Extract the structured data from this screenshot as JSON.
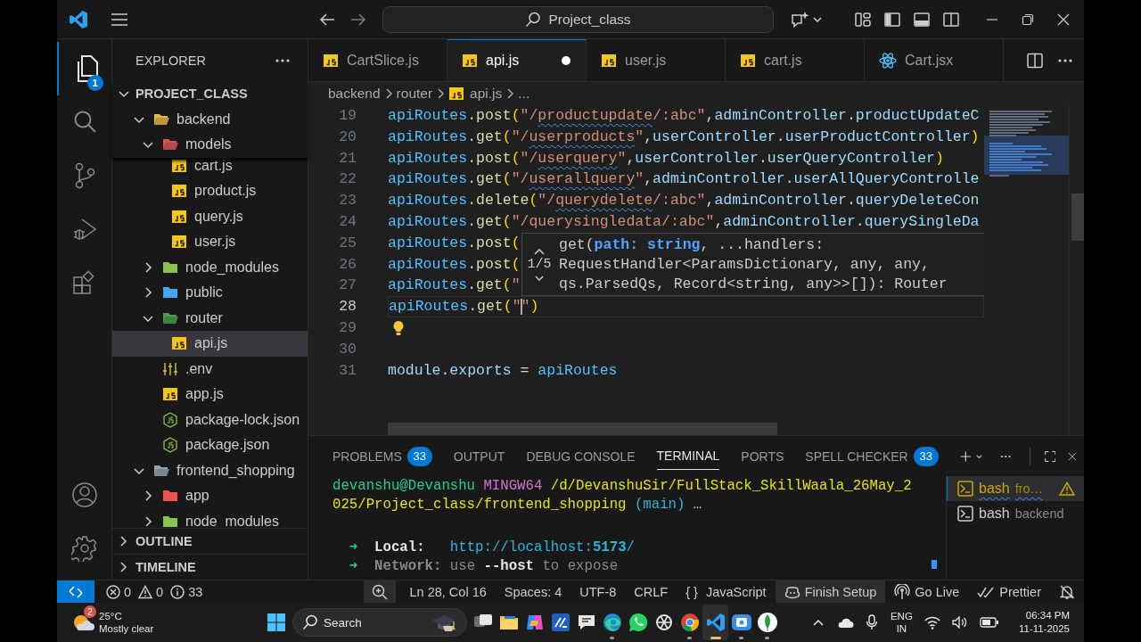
{
  "title_bar": {
    "nav": [
      {
        "kind": "back",
        "disabled": false
      },
      {
        "kind": "forward",
        "disabled": true
      }
    ],
    "search": "Project_class"
  },
  "activity_bar": {
    "items": [
      {
        "kind": "explorer",
        "selected": true,
        "badge": "1"
      },
      {
        "kind": "search",
        "selected": false
      },
      {
        "kind": "source-control",
        "selected": false
      },
      {
        "kind": "run-debug",
        "selected": false
      },
      {
        "kind": "extensions",
        "selected": false
      }
    ],
    "bottom": [
      {
        "kind": "account"
      },
      {
        "kind": "settings"
      }
    ]
  },
  "sidebar": {
    "title": "EXPLORER",
    "tree": [
      {
        "label": "PROJECT_CLASS",
        "kind": "root",
        "expanded": true,
        "selected": false,
        "children": [
          {
            "label": "backend",
            "kind": "folder",
            "color": "#e8b84a",
            "expanded": true,
            "selected": false,
            "children": [
              {
                "label": "models",
                "kind": "folder",
                "color": "#e05252",
                "expanded": true,
                "selected": false,
                "children": [
                  {
                    "label": "cart.js",
                    "kind": "js",
                    "selected": false
                  },
                  {
                    "label": "product.js",
                    "kind": "js",
                    "selected": false
                  },
                  {
                    "label": "query.js",
                    "kind": "js",
                    "selected": false
                  },
                  {
                    "label": "user.js",
                    "kind": "js",
                    "selected": false
                  }
                ]
              },
              {
                "label": "node_modules",
                "kind": "folder",
                "color": "#8bc34a",
                "expanded": false,
                "selected": false
              },
              {
                "label": "public",
                "kind": "folder",
                "color": "#42a5f5",
                "expanded": false,
                "selected": false
              },
              {
                "label": "router",
                "kind": "folder",
                "color": "#43a047",
                "expanded": true,
                "selected": false,
                "children": [
                  {
                    "label": "api.js",
                    "kind": "js",
                    "selected": true
                  }
                ]
              },
              {
                "label": ".env",
                "kind": "env",
                "selected": false
              },
              {
                "label": "app.js",
                "kind": "js",
                "selected": false
              },
              {
                "label": "package-lock.json",
                "kind": "json",
                "selected": false
              },
              {
                "label": "package.json",
                "kind": "json",
                "selected": false
              }
            ]
          },
          {
            "label": "frontend_shopping",
            "kind": "folder",
            "color": "#90a4ae",
            "expanded": true,
            "selected": false,
            "children": [
              {
                "label": "app",
                "kind": "folder",
                "color": "#ef5350",
                "expanded": false,
                "selected": false
              },
              {
                "label": "node_modules",
                "kind": "folder",
                "color": "#8bc34a",
                "expanded": false,
                "selected": false
              }
            ]
          }
        ]
      }
    ],
    "sections": [
      {
        "label": "OUTLINE",
        "expanded": false
      },
      {
        "label": "TIMELINE",
        "expanded": false
      }
    ]
  },
  "editor": {
    "tabs": [
      {
        "label": "CartSlice.js",
        "kind": "js",
        "selected": false,
        "modified": false
      },
      {
        "label": "api.js",
        "kind": "js",
        "selected": true,
        "modified": true
      },
      {
        "label": "user.js",
        "kind": "js",
        "selected": false,
        "modified": false
      },
      {
        "label": "cart.js",
        "kind": "js",
        "selected": false,
        "modified": false
      },
      {
        "label": "Cart.jsx",
        "kind": "react",
        "selected": false,
        "modified": false
      }
    ],
    "breadcrumb": [
      {
        "label": "backend",
        "kind": "folder"
      },
      {
        "label": "router",
        "kind": "folder"
      },
      {
        "label": "api.js",
        "kind": "js"
      },
      {
        "label": "...",
        "kind": "more"
      }
    ],
    "lines": [
      {
        "number": "19",
        "current": false,
        "lightbulb": false,
        "tokens": [
          {
            "kind": "const",
            "text": "apiRoutes"
          },
          {
            "kind": "punc",
            "text": "."
          },
          {
            "kind": "method",
            "text": "post"
          },
          {
            "kind": "bracket",
            "text": "("
          },
          {
            "kind": "str",
            "text": "\"/"
          },
          {
            "kind": "str-warn",
            "text": "productupdate"
          },
          {
            "kind": "str",
            "text": "/:abc\""
          },
          {
            "kind": "punc",
            "text": ","
          },
          {
            "kind": "var",
            "text": "adminController"
          },
          {
            "kind": "punc",
            "text": "."
          },
          {
            "kind": "var",
            "text": "productUpdateC"
          }
        ]
      },
      {
        "number": "20",
        "current": false,
        "lightbulb": false,
        "tokens": [
          {
            "kind": "const",
            "text": "apiRoutes"
          },
          {
            "kind": "punc",
            "text": "."
          },
          {
            "kind": "method",
            "text": "get"
          },
          {
            "kind": "bracket",
            "text": "("
          },
          {
            "kind": "str",
            "text": "\"/"
          },
          {
            "kind": "str-warn",
            "text": "userproducts"
          },
          {
            "kind": "str",
            "text": "\""
          },
          {
            "kind": "punc",
            "text": ","
          },
          {
            "kind": "var",
            "text": "userController"
          },
          {
            "kind": "punc",
            "text": "."
          },
          {
            "kind": "var",
            "text": "userProductController"
          },
          {
            "kind": "bracket",
            "text": ")"
          }
        ]
      },
      {
        "number": "21",
        "current": false,
        "lightbulb": false,
        "tokens": [
          {
            "kind": "const",
            "text": "apiRoutes"
          },
          {
            "kind": "punc",
            "text": "."
          },
          {
            "kind": "method",
            "text": "post"
          },
          {
            "kind": "bracket",
            "text": "("
          },
          {
            "kind": "str",
            "text": "\"/"
          },
          {
            "kind": "str-warn",
            "text": "userquery"
          },
          {
            "kind": "str",
            "text": "\""
          },
          {
            "kind": "punc",
            "text": ","
          },
          {
            "kind": "var",
            "text": "userController"
          },
          {
            "kind": "punc",
            "text": "."
          },
          {
            "kind": "var",
            "text": "userQueryController"
          },
          {
            "kind": "bracket",
            "text": ")"
          }
        ]
      },
      {
        "number": "22",
        "current": false,
        "lightbulb": false,
        "tokens": [
          {
            "kind": "const",
            "text": "apiRoutes"
          },
          {
            "kind": "punc",
            "text": "."
          },
          {
            "kind": "method",
            "text": "get"
          },
          {
            "kind": "bracket",
            "text": "("
          },
          {
            "kind": "str",
            "text": "\"/"
          },
          {
            "kind": "str-warn",
            "text": "userallquery"
          },
          {
            "kind": "str",
            "text": "\""
          },
          {
            "kind": "punc",
            "text": ","
          },
          {
            "kind": "var",
            "text": "adminController"
          },
          {
            "kind": "punc",
            "text": "."
          },
          {
            "kind": "var",
            "text": "userAllQueryControlle"
          }
        ]
      },
      {
        "number": "23",
        "current": false,
        "lightbulb": false,
        "tokens": [
          {
            "kind": "const",
            "text": "apiRoutes"
          },
          {
            "kind": "punc",
            "text": "."
          },
          {
            "kind": "method",
            "text": "delete"
          },
          {
            "kind": "bracket",
            "text": "("
          },
          {
            "kind": "str",
            "text": "\"/"
          },
          {
            "kind": "str-warn",
            "text": "querydelete"
          },
          {
            "kind": "str",
            "text": "/:abc\""
          },
          {
            "kind": "punc",
            "text": ","
          },
          {
            "kind": "var",
            "text": "adminController"
          },
          {
            "kind": "punc",
            "text": "."
          },
          {
            "kind": "var",
            "text": "queryDeleteCon"
          }
        ]
      },
      {
        "number": "24",
        "current": false,
        "lightbulb": false,
        "tokens": [
          {
            "kind": "const",
            "text": "apiRoutes"
          },
          {
            "kind": "punc",
            "text": "."
          },
          {
            "kind": "method",
            "text": "get"
          },
          {
            "kind": "bracket",
            "text": "("
          },
          {
            "kind": "str",
            "text": "\"/querysingledata/:abc\""
          },
          {
            "kind": "punc",
            "text": ","
          },
          {
            "kind": "var",
            "text": "adminController"
          },
          {
            "kind": "punc",
            "text": "."
          },
          {
            "kind": "var",
            "text": "querySingleDa"
          }
        ]
      },
      {
        "number": "25",
        "current": false,
        "lightbulb": false,
        "tokens": [
          {
            "kind": "const",
            "text": "apiRoutes"
          },
          {
            "kind": "punc",
            "text": "."
          },
          {
            "kind": "method",
            "text": "post"
          },
          {
            "kind": "bracket",
            "text": "("
          }
        ]
      },
      {
        "number": "26",
        "current": false,
        "lightbulb": false,
        "tokens": [
          {
            "kind": "const",
            "text": "apiRoutes"
          },
          {
            "kind": "punc",
            "text": "."
          },
          {
            "kind": "method",
            "text": "post"
          },
          {
            "kind": "bracket",
            "text": "("
          }
        ]
      },
      {
        "number": "27",
        "current": false,
        "lightbulb": false,
        "tokens": [
          {
            "kind": "const",
            "text": "apiRoutes"
          },
          {
            "kind": "punc",
            "text": "."
          },
          {
            "kind": "method",
            "text": "get"
          },
          {
            "kind": "bracket",
            "text": "("
          },
          {
            "kind": "str",
            "text": "\""
          }
        ]
      },
      {
        "number": "28",
        "current": true,
        "lightbulb": false,
        "tokens": [
          {
            "kind": "const",
            "text": "apiRoutes"
          },
          {
            "kind": "punc",
            "text": "."
          },
          {
            "kind": "method",
            "text": "get"
          },
          {
            "kind": "bracket",
            "text": "("
          },
          {
            "kind": "str",
            "text": "\""
          },
          {
            "kind": "cursor"
          },
          {
            "kind": "str",
            "text": "\""
          },
          {
            "kind": "bracket",
            "text": ")"
          }
        ]
      },
      {
        "number": "29",
        "current": false,
        "lightbulb": true
      },
      {
        "number": "30",
        "current": false,
        "lightbulb": false
      },
      {
        "number": "31",
        "current": false,
        "lightbulb": false,
        "tokens": [
          {
            "kind": "var",
            "text": "module"
          },
          {
            "kind": "punc",
            "text": "."
          },
          {
            "kind": "var",
            "text": "exports"
          },
          {
            "kind": "punc",
            "text": " = "
          },
          {
            "kind": "const",
            "text": "apiRoutes"
          }
        ]
      }
    ],
    "hover": {
      "counter": "1/5",
      "lines": [
        "get(**path: string**, ...handlers:",
        "RequestHandler<ParamsDictionary, any, any,",
        "qs.ParsedQs, Record<string, any>>[]): Router"
      ]
    }
  },
  "panel": {
    "tabs": [
      {
        "label": "PROBLEMS",
        "badge": "33",
        "selected": false
      },
      {
        "label": "OUTPUT",
        "selected": false
      },
      {
        "label": "DEBUG CONSOLE",
        "selected": false
      },
      {
        "label": "TERMINAL",
        "selected": true
      },
      {
        "label": "PORTS",
        "selected": false
      },
      {
        "label": "SPELL CHECKER",
        "badge": "33",
        "selected": false
      }
    ],
    "terminal": [
      {
        "kind": "text",
        "segments": [
          {
            "kind": "user",
            "text": "devanshu@Devanshu "
          },
          {
            "kind": "host",
            "text": "MINGW64 "
          },
          {
            "kind": "path",
            "text": "/d/DevanshuSir/FullStack_SkillWaala_26May_2"
          }
        ]
      },
      {
        "kind": "text",
        "segments": [
          {
            "kind": "path",
            "text": "025/Project_class/frontend_shopping "
          },
          {
            "kind": "branch",
            "text": "(main)"
          },
          {
            "kind": "plain",
            "text": " …"
          }
        ]
      },
      {
        "kind": "blank"
      },
      {
        "kind": "text",
        "segments": [
          {
            "kind": "arrow",
            "text": "  ➜  "
          },
          {
            "kind": "label",
            "text": "Local:   "
          },
          {
            "kind": "link",
            "text": "http://localhost:"
          },
          {
            "kind": "link-bold",
            "text": "5173"
          },
          {
            "kind": "link",
            "text": "/"
          }
        ]
      },
      {
        "kind": "text",
        "segments": [
          {
            "kind": "arrow",
            "text": "  ➜  "
          },
          {
            "kind": "label-dim",
            "text": "Network:"
          },
          {
            "kind": "dim",
            "text": " use "
          },
          {
            "kind": "label",
            "text": "--host"
          },
          {
            "kind": "dim",
            "text": " to expose"
          }
        ]
      }
    ],
    "sessions": [
      {
        "label": "bash",
        "detail": "fro…",
        "warning": true,
        "selected": true
      },
      {
        "label": "bash",
        "detail": "backend",
        "warning": false,
        "selected": false
      }
    ]
  },
  "status_bar": {
    "problems": {
      "errors": "0",
      "warnings": "0",
      "infos": "33"
    },
    "items": [
      {
        "kind": "zoom",
        "highlighted": true
      },
      {
        "kind": "text",
        "text": "Ln 28, Col 16",
        "highlighted": false
      },
      {
        "kind": "text",
        "text": "Spaces: 4",
        "highlighted": false
      },
      {
        "kind": "text",
        "text": "UTF-8",
        "highlighted": false
      },
      {
        "kind": "text",
        "text": "CRLF",
        "highlighted": false
      },
      {
        "kind": "language",
        "glyph": "{ }",
        "text": "JavaScript",
        "highlighted": false
      },
      {
        "kind": "copilot",
        "text": "Finish Setup",
        "highlighted": true
      },
      {
        "kind": "live",
        "text": "Go Live",
        "highlighted": false
      },
      {
        "kind": "prettier",
        "text": "Prettier",
        "highlighted": false
      },
      {
        "kind": "bell",
        "highlighted": false
      }
    ]
  },
  "taskbar": {
    "weather": {
      "badge": "2",
      "temperature": "25°C",
      "condition": "Mostly clear"
    },
    "search": "Search",
    "apps": [
      {
        "kind": "task-view",
        "running": false,
        "active": false
      },
      {
        "kind": "explorer",
        "running": false,
        "active": false
      },
      {
        "kind": "colorful",
        "running": false,
        "active": false
      },
      {
        "kind": "blue-tile",
        "running": false,
        "active": false
      },
      {
        "kind": "feedback",
        "running": false,
        "active": false
      },
      {
        "kind": "edge",
        "running": true,
        "active": false
      },
      {
        "kind": "whatsapp",
        "running": false,
        "active": false
      },
      {
        "kind": "knot",
        "running": false,
        "active": false
      },
      {
        "kind": "chrome",
        "running": true,
        "active": false
      },
      {
        "kind": "vscode",
        "running": true,
        "active": true
      },
      {
        "kind": "recorder",
        "running": true,
        "active": false
      },
      {
        "kind": "leaf",
        "running": true,
        "active": false
      }
    ],
    "tray": {
      "language": "ENG",
      "region": "IN",
      "time": "06:34 PM",
      "date": "11-11-2025"
    }
  }
}
